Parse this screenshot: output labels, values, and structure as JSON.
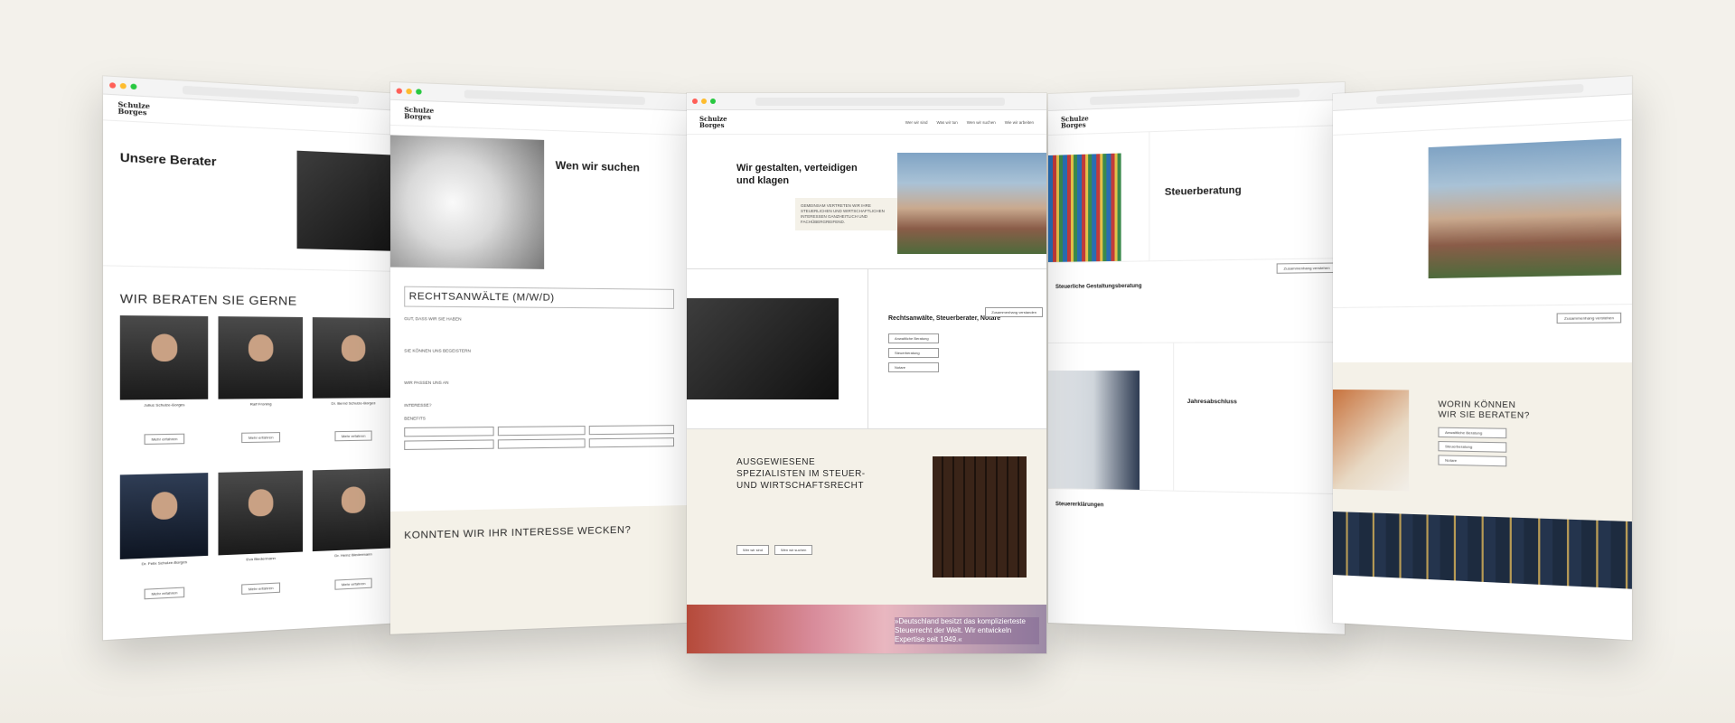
{
  "windows": {
    "w1": {
      "heading": "Unsere Berater",
      "section": "WIR BERATEN SIE GERNE",
      "people": [
        {
          "name": "Julius Schulze-Borges"
        },
        {
          "name": "Ralf Froning"
        },
        {
          "name": "Dr. Bernd Schulze-Borges"
        },
        {
          "name": "Dr. Felix Schulze-Borges"
        },
        {
          "name": "Eva Biedermann"
        },
        {
          "name": "Dr. Heinz Biedermann"
        }
      ],
      "button": "Mehr erfahren"
    },
    "w2": {
      "heading": "Wen wir suchen",
      "job": "RECHTSANWÄLTE (M/W/D)",
      "labels": [
        "GUT, DASS WIR SIE HABEN",
        "SIE KÖNNEN UNS BEGEISTERN",
        "WIR PASSEN UNS AN",
        "INTERESSE?",
        "BENEFITS"
      ],
      "cta": "KONNTEN WIR IHR INTERESSE WECKEN?"
    },
    "w3": {
      "logo_line1": "Schulze",
      "logo_line2": "Borges",
      "nav": [
        "Wer wir sind",
        "Was wir tun",
        "Wen wir suchen",
        "Wie wir arbeiten"
      ],
      "hero": "Wir gestalten, verteidigen und klagen",
      "hero_sub": "GEMEINSAM VERTRETEN WIR IHRE STEUERLICHEN UND WIRTSCHAFTLICHEN INTERESSEN GANZHEITLICH UND FACHÜBERGREIFEND.",
      "services_title": "Rechtsanwälte, Steuerberater, Notare",
      "services": [
        "Anwaltliche Beratung",
        "Steuerberatung",
        "Notare"
      ],
      "tag": "Zusammenhang verstanden",
      "spec_title": "AUSGEWIESENE SPEZIALISTEN IM STEUER- UND WIRTSCHAFTSRECHT",
      "spec_buttons": [
        "Wer wir sind",
        "Wen wir suchen"
      ],
      "quote": "»Deutschland besitzt das komplizierteste Steuerrecht der Welt. Wir entwickeln Expertise seit 1949.«"
    },
    "w4": {
      "heading": "Steuerberatung",
      "sub1": "Steuerliche Gestaltungsberatung",
      "sub2": "Jahresabschluss",
      "sub3": "Steuererklärungen",
      "tag": "Zusammenhang verstehen"
    },
    "w5": {
      "heading_line1": "WORIN KÖNNEN",
      "heading_line2": "WIR SIE BERATEN?",
      "services": [
        "Anwaltliche Beratung",
        "Steuerberatung",
        "Notare"
      ],
      "tag": "Zusammenhang verstehen"
    }
  }
}
